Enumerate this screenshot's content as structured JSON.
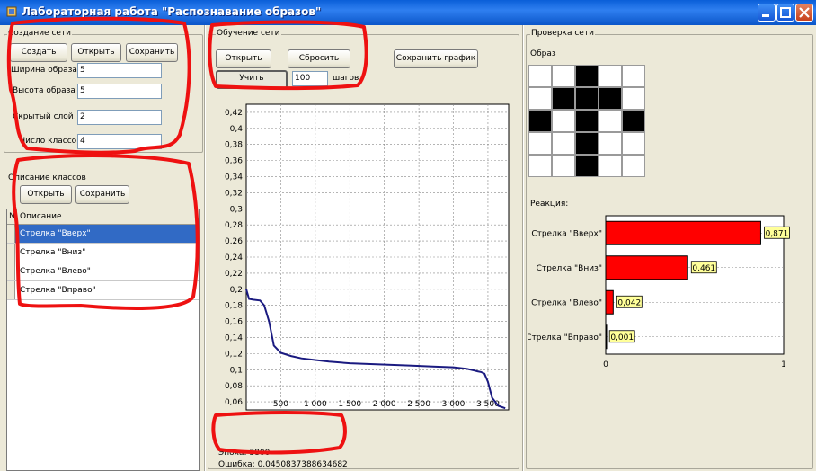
{
  "window": {
    "title": "Лабораторная работа \"Распознавание образов\""
  },
  "network_create": {
    "group_label": "Создание сети",
    "buttons": {
      "create": "Создать",
      "open": "Открыть",
      "save": "Сохранить"
    },
    "fields": [
      {
        "label": "Ширина образа",
        "value": "5"
      },
      {
        "label": "Высота образа",
        "value": "5"
      },
      {
        "label": "Скрытый слой",
        "value": "2"
      },
      {
        "label": "Число классов",
        "value": "4"
      }
    ]
  },
  "classes": {
    "group_label": "Описание классов",
    "buttons": {
      "open": "Открыть",
      "save": "Сохранить"
    },
    "columns": [
      "№",
      "Описание"
    ],
    "rows": [
      {
        "desc": "Стрелка \"Вверх\"",
        "selected": true
      },
      {
        "desc": "Стрелка \"Вниз\"",
        "selected": false
      },
      {
        "desc": "Стрелка \"Влево\"",
        "selected": false
      },
      {
        "desc": "Стрелка \"Вправо\"",
        "selected": false
      }
    ]
  },
  "training": {
    "group_label": "Обучение сети",
    "buttons": {
      "open": "Открыть",
      "reset": "Сбросить",
      "save_chart": "Сохранить график",
      "train": "Учить"
    },
    "steps_value": "100",
    "steps_label": "шагов",
    "epoch_text": "Эпоха: 3800",
    "error_text": "Ошибка: 0,0450837388634682"
  },
  "check": {
    "group_label": "Проверка сети",
    "pattern_label": "Образ",
    "reaction_label": "Реакция:",
    "pattern": [
      [
        0,
        0,
        1,
        0,
        0
      ],
      [
        0,
        1,
        1,
        1,
        0
      ],
      [
        1,
        0,
        1,
        0,
        1
      ],
      [
        0,
        0,
        1,
        0,
        0
      ],
      [
        0,
        0,
        1,
        0,
        0
      ]
    ]
  },
  "colors": {
    "accent_selection": "#316ac5",
    "curve": "#1a1a80",
    "bar_fill": "#ff0000",
    "value_box": "#ffff99",
    "annotation": "#ee1111"
  },
  "chart_data": [
    {
      "type": "line",
      "title": "",
      "xlabel": "",
      "ylabel": "",
      "xlim": [
        0,
        3800
      ],
      "ylim": [
        0.05,
        0.43
      ],
      "y_ticks": [
        "0,42",
        "0,4",
        "0,38",
        "0,36",
        "0,34",
        "0,32",
        "0,3",
        "0,28",
        "0,26",
        "0,24",
        "0,22",
        "0,2",
        "0,18",
        "0,16",
        "0,14",
        "0,12",
        "0,1",
        "0,08",
        "0,06"
      ],
      "y_tick_values": [
        0.42,
        0.4,
        0.38,
        0.36,
        0.34,
        0.32,
        0.3,
        0.28,
        0.26,
        0.24,
        0.22,
        0.2,
        0.18,
        0.16,
        0.14,
        0.12,
        0.1,
        0.08,
        0.06
      ],
      "x_ticks": [
        "500",
        "1 000",
        "1 500",
        "2 000",
        "2 500",
        "3 000",
        "3 500"
      ],
      "x_tick_values": [
        500,
        1000,
        1500,
        2000,
        2500,
        3000,
        3500
      ],
      "grid": true,
      "series": [
        {
          "x": [
            0,
            40,
            100,
            200,
            260,
            330,
            400,
            500,
            650,
            800,
            1000,
            1200,
            1500,
            1800,
            2100,
            2400,
            2700,
            3000,
            3200,
            3300,
            3350,
            3400,
            3450,
            3500,
            3560,
            3650,
            3750
          ],
          "y": [
            0.2,
            0.188,
            0.187,
            0.186,
            0.18,
            0.16,
            0.13,
            0.121,
            0.117,
            0.114,
            0.112,
            0.11,
            0.108,
            0.107,
            0.106,
            0.105,
            0.104,
            0.103,
            0.101,
            0.099,
            0.098,
            0.097,
            0.095,
            0.085,
            0.065,
            0.055,
            0.052
          ]
        }
      ]
    },
    {
      "type": "bar",
      "orientation": "horizontal",
      "categories": [
        "Стрелка \"Вверх\"",
        "Стрелка \"Вниз\"",
        "Стрелка \"Влево\"",
        "Стрелка \"Вправо\""
      ],
      "values": [
        0.871,
        0.461,
        0.042,
        0.001
      ],
      "value_labels": [
        "0,871",
        "0,461",
        "0,042",
        "0,001"
      ],
      "xlim": [
        0,
        1
      ],
      "x_ticks": [
        "0",
        "1"
      ]
    }
  ]
}
